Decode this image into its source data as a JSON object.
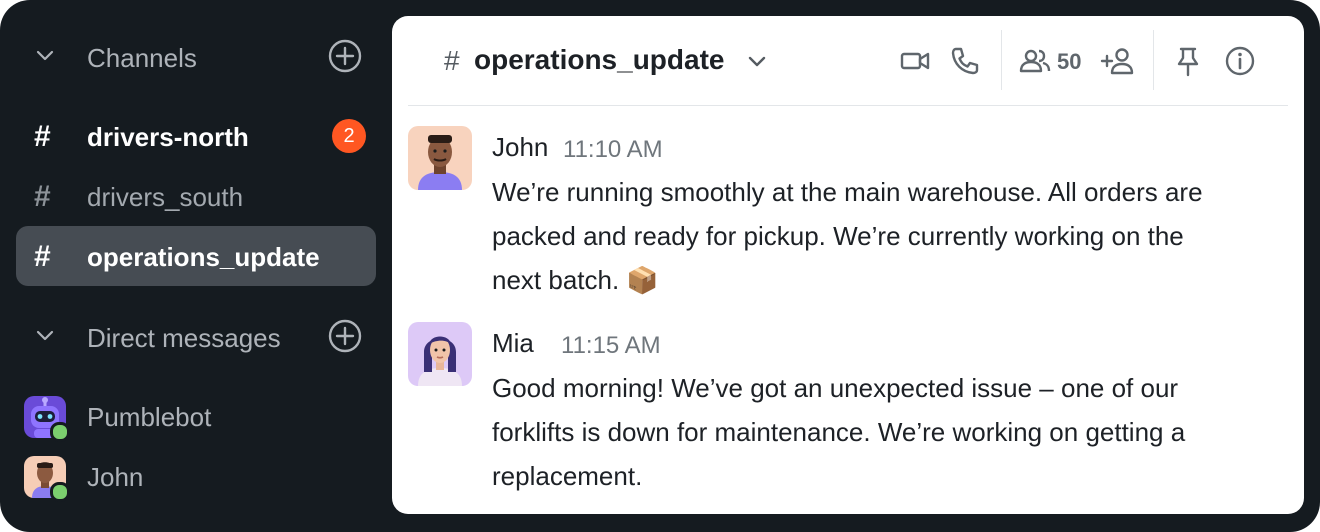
{
  "sidebar": {
    "channels_label": "Channels",
    "channels": [
      {
        "label": "drivers-north",
        "badge": "2",
        "state": "unread"
      },
      {
        "label": "drivers_south",
        "badge": "",
        "state": "normal"
      },
      {
        "label": "operations_update",
        "badge": "",
        "state": "active"
      }
    ],
    "hash_glyph": "#",
    "dm_label": "Direct messages",
    "dms": [
      {
        "label": "Pumblebot",
        "icon": "robot-avatar",
        "status": "online"
      },
      {
        "label": "John",
        "icon": "person-avatar",
        "status": "online"
      }
    ]
  },
  "header": {
    "hash_glyph": "#",
    "channel_name": "operations_update",
    "member_count": "50",
    "icons": [
      "video-icon",
      "phone-icon",
      "members-icon",
      "add-member-icon",
      "pin-icon",
      "info-icon"
    ]
  },
  "messages": [
    {
      "author": "John",
      "time": "11:10 AM",
      "lines": [
        "We’re running smoothly at the main warehouse. All orders are",
        "packed and ready for pickup. We’re currently working on the",
        "next batch. 📦"
      ]
    },
    {
      "author": "Mia",
      "time": "11:15 AM",
      "lines": [
        "Good morning! We’ve got an unexpected issue – one of our",
        "forklifts is down for maintenance. We’re working on getting a",
        "replacement."
      ]
    }
  ],
  "colors": {
    "background": "#151b20",
    "active_item": "#464c53",
    "badge": "#ff5722",
    "online": "#7bcf6e"
  }
}
